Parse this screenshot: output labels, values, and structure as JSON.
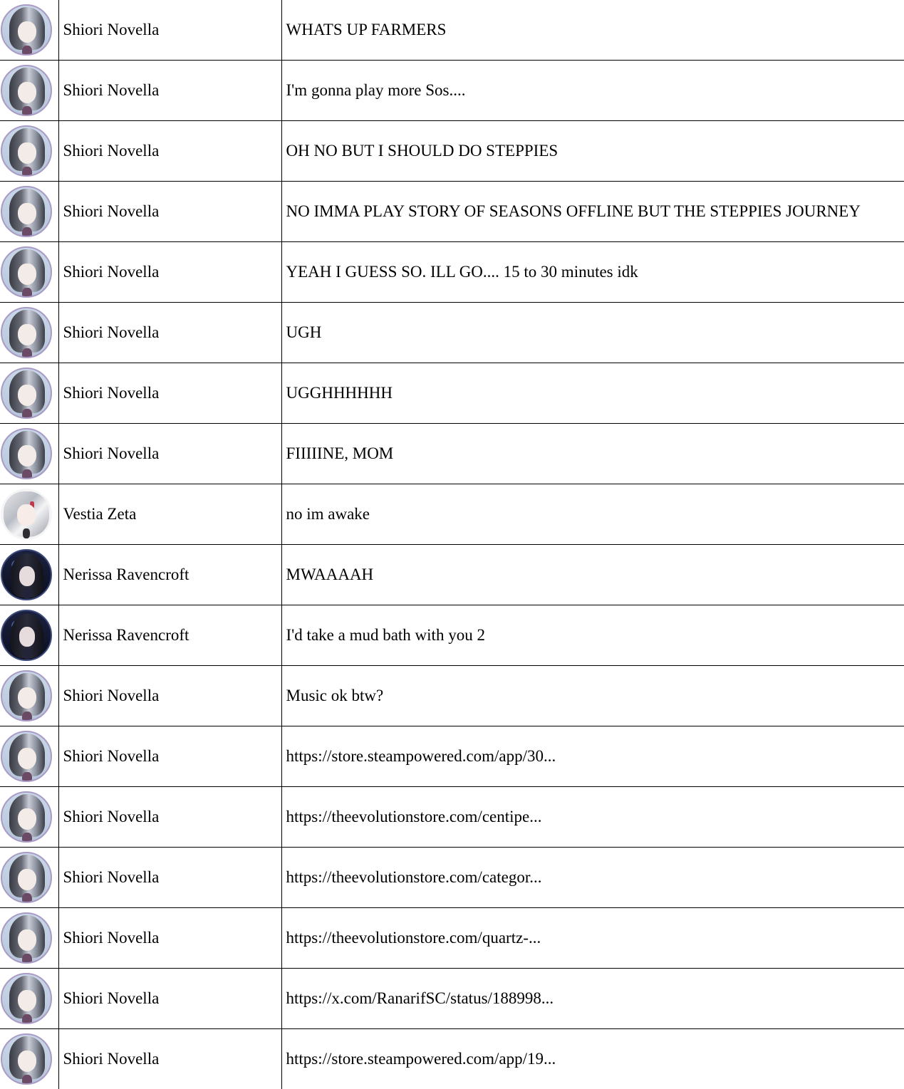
{
  "messages": [
    {
      "author": "Shiori Novella",
      "avatar": "shiori-avatar",
      "text": "WHATS UP FARMERS"
    },
    {
      "author": "Shiori Novella",
      "avatar": "shiori-avatar",
      "text": "I'm gonna play more Sos...."
    },
    {
      "author": "Shiori Novella",
      "avatar": "shiori-avatar",
      "text": "OH NO BUT I SHOULD DO STEPPIES"
    },
    {
      "author": "Shiori Novella",
      "avatar": "shiori-avatar",
      "text": "NO IMMA PLAY STORY OF SEASONS OFFLINE BUT THE STEPPIES JOURNEY"
    },
    {
      "author": "Shiori Novella",
      "avatar": "shiori-avatar",
      "text": "YEAH I GUESS SO. ILL GO.... 15 to 30 minutes idk"
    },
    {
      "author": "Shiori Novella",
      "avatar": "shiori-avatar",
      "text": "UGH"
    },
    {
      "author": "Shiori Novella",
      "avatar": "shiori-avatar",
      "text": "UGGHHHHHH"
    },
    {
      "author": "Shiori Novella",
      "avatar": "shiori-avatar",
      "text": "FIIIIINE, MOM"
    },
    {
      "author": "Vestia Zeta",
      "avatar": "vestia-avatar",
      "text": "no im awake"
    },
    {
      "author": "Nerissa Ravencroft",
      "avatar": "nerissa-avatar",
      "text": "MWAAAAH"
    },
    {
      "author": "Nerissa Ravencroft",
      "avatar": "nerissa-avatar",
      "text": "I'd take a mud bath with you 2"
    },
    {
      "author": "Shiori Novella",
      "avatar": "shiori-avatar",
      "text": "Music ok btw?"
    },
    {
      "author": "Shiori Novella",
      "avatar": "shiori-avatar",
      "text": "https://store.steampowered.com/app/30..."
    },
    {
      "author": "Shiori Novella",
      "avatar": "shiori-avatar",
      "text": "https://theevolutionstore.com/centipe..."
    },
    {
      "author": "Shiori Novella",
      "avatar": "shiori-avatar",
      "text": "https://theevolutionstore.com/categor..."
    },
    {
      "author": "Shiori Novella",
      "avatar": "shiori-avatar",
      "text": "https://theevolutionstore.com/quartz-..."
    },
    {
      "author": "Shiori Novella",
      "avatar": "shiori-avatar",
      "text": "https://x.com/RanarifSC/status/188998..."
    },
    {
      "author": "Shiori Novella",
      "avatar": "shiori-avatar",
      "text": "https://store.steampowered.com/app/19..."
    }
  ]
}
